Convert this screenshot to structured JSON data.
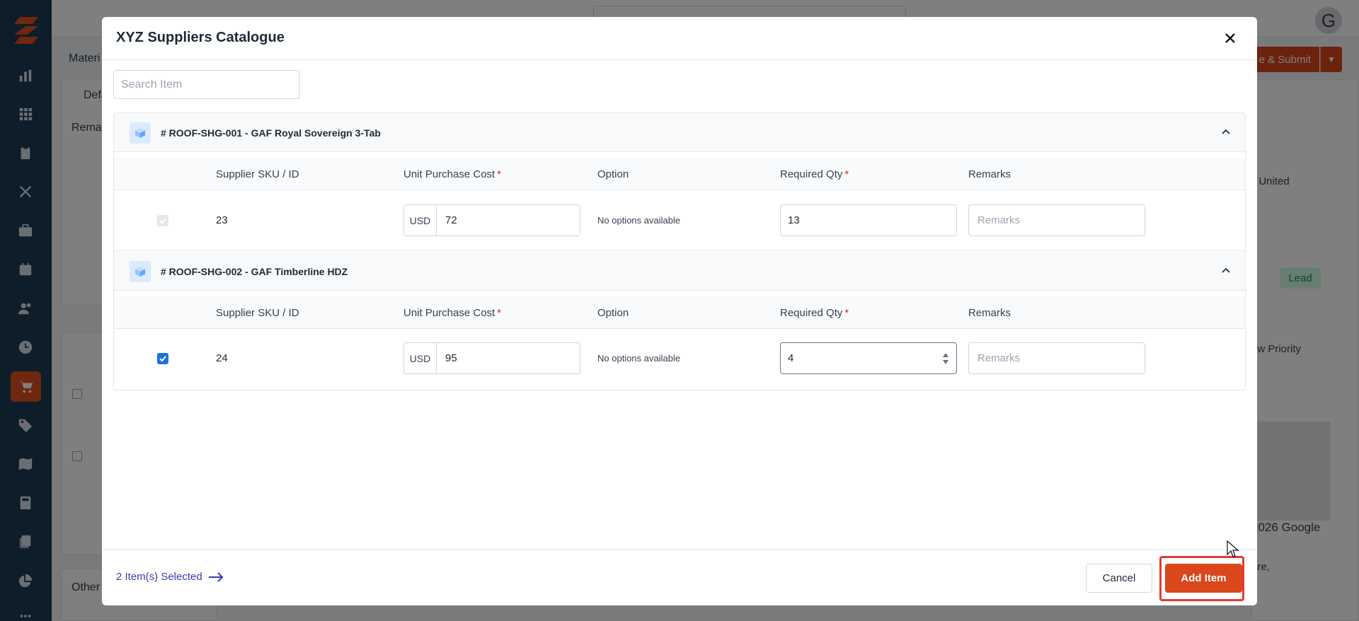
{
  "background": {
    "tab_partial": "Materi",
    "default_partial": "Defa",
    "remarks_partial": "Remar",
    "other_partial": "Other",
    "submit_partial": "e & Submit",
    "location_partial": ", United",
    "lead_badge": "Lead",
    "priority_partial": "ow Priority",
    "map_copyright": "2026 Google",
    "address_partial": "ore,",
    "avatar_initial": "G"
  },
  "modal": {
    "title": "XYZ Suppliers Catalogue",
    "search_placeholder": "Search Item",
    "columns": {
      "sku": "Supplier SKU / ID",
      "cost": "Unit Purchase Cost",
      "option": "Option",
      "qty": "Required Qty",
      "remarks": "Remarks"
    },
    "required_marker": "*",
    "groups": [
      {
        "title": "# ROOF-SHG-001 - GAF Royal Sovereign 3-Tab",
        "row": {
          "checked": true,
          "disabled": true,
          "sku": "23",
          "currency": "USD",
          "cost": "72",
          "option": "No options available",
          "qty": "13",
          "remarks_placeholder": "Remarks"
        }
      },
      {
        "title": "# ROOF-SHG-002 - GAF Timberline HDZ",
        "row": {
          "checked": true,
          "disabled": false,
          "sku": "24",
          "currency": "USD",
          "cost": "95",
          "option": "No options available",
          "qty": "4",
          "remarks_placeholder": "Remarks"
        }
      }
    ],
    "footer": {
      "selected_text": "2 Item(s) Selected",
      "cancel_label": "Cancel",
      "add_label": "Add Item"
    }
  },
  "colors": {
    "sidebar": "#1b3a55",
    "accent": "#d9471b",
    "highlight": "#e53935",
    "checkbox": "#1d6fe0"
  }
}
